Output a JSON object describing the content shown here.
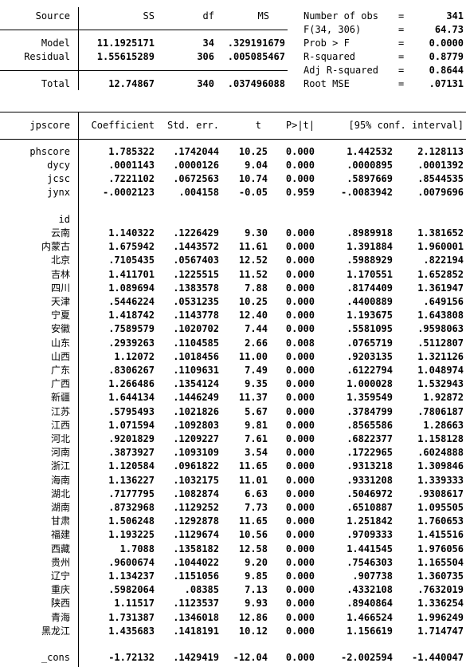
{
  "anova": {
    "headers": {
      "source": "Source",
      "ss": "SS",
      "df": "df",
      "ms": "MS"
    },
    "rows": [
      {
        "source": "Model",
        "ss": "11.1925171",
        "df": "34",
        "ms": ".329191679"
      },
      {
        "source": "Residual",
        "ss": "1.55615289",
        "df": "306",
        "ms": ".005085467"
      }
    ],
    "total": {
      "source": "Total",
      "ss": "12.74867",
      "df": "340",
      "ms": ".037496088"
    }
  },
  "stats": [
    {
      "label": "Number of obs",
      "eq": "=",
      "value": "341"
    },
    {
      "label": "F(34, 306)",
      "eq": "=",
      "value": "64.73"
    },
    {
      "label": "Prob > F",
      "eq": "=",
      "value": "0.0000"
    },
    {
      "label": "R-squared",
      "eq": "=",
      "value": "0.8779"
    },
    {
      "label": "Adj R-squared",
      "eq": "=",
      "value": "0.8644"
    },
    {
      "label": "Root MSE",
      "eq": "=",
      "value": ".07131"
    }
  ],
  "coef_header": {
    "var": "jpscore",
    "coef": "Coefficient",
    "se": "Std. err.",
    "t": "t",
    "p": "P>|t|",
    "ci": "[95% conf. interval]"
  },
  "vars": [
    {
      "name": "phscore",
      "coef": "1.785322",
      "se": ".1742044",
      "t": "10.25",
      "p": "0.000",
      "lo": "1.442532",
      "hi": "2.128113"
    },
    {
      "name": "dycy",
      "coef": ".0001143",
      "se": ".0000126",
      "t": "9.04",
      "p": "0.000",
      "lo": ".0000895",
      "hi": ".0001392"
    },
    {
      "name": "jcsc",
      "coef": ".7221102",
      "se": ".0672563",
      "t": "10.74",
      "p": "0.000",
      "lo": ".5897669",
      "hi": ".8544535"
    },
    {
      "name": "jynx",
      "coef": "-.0002123",
      "se": ".004158",
      "t": "-0.05",
      "p": "0.959",
      "lo": "-.0083942",
      "hi": ".0079696"
    }
  ],
  "id_label": "id",
  "ids": [
    {
      "name": "云南",
      "coef": "1.140322",
      "se": ".1226429",
      "t": "9.30",
      "p": "0.000",
      "lo": ".8989918",
      "hi": "1.381652"
    },
    {
      "name": "内蒙古",
      "coef": "1.675942",
      "se": ".1443572",
      "t": "11.61",
      "p": "0.000",
      "lo": "1.391884",
      "hi": "1.960001"
    },
    {
      "name": "北京",
      "coef": ".7105435",
      "se": ".0567403",
      "t": "12.52",
      "p": "0.000",
      "lo": ".5988929",
      "hi": ".822194"
    },
    {
      "name": "吉林",
      "coef": "1.411701",
      "se": ".1225515",
      "t": "11.52",
      "p": "0.000",
      "lo": "1.170551",
      "hi": "1.652852"
    },
    {
      "name": "四川",
      "coef": "1.089694",
      "se": ".1383578",
      "t": "7.88",
      "p": "0.000",
      "lo": ".8174409",
      "hi": "1.361947"
    },
    {
      "name": "天津",
      "coef": ".5446224",
      "se": ".0531235",
      "t": "10.25",
      "p": "0.000",
      "lo": ".4400889",
      "hi": ".649156"
    },
    {
      "name": "宁夏",
      "coef": "1.418742",
      "se": ".1143778",
      "t": "12.40",
      "p": "0.000",
      "lo": "1.193675",
      "hi": "1.643808"
    },
    {
      "name": "安徽",
      "coef": ".7589579",
      "se": ".1020702",
      "t": "7.44",
      "p": "0.000",
      "lo": ".5581095",
      "hi": ".9598063"
    },
    {
      "name": "山东",
      "coef": ".2939263",
      "se": ".1104585",
      "t": "2.66",
      "p": "0.008",
      "lo": ".0765719",
      "hi": ".5112807"
    },
    {
      "name": "山西",
      "coef": "1.12072",
      "se": ".1018456",
      "t": "11.00",
      "p": "0.000",
      "lo": ".9203135",
      "hi": "1.321126"
    },
    {
      "name": "广东",
      "coef": ".8306267",
      "se": ".1109631",
      "t": "7.49",
      "p": "0.000",
      "lo": ".6122794",
      "hi": "1.048974"
    },
    {
      "name": "广西",
      "coef": "1.266486",
      "se": ".1354124",
      "t": "9.35",
      "p": "0.000",
      "lo": "1.000028",
      "hi": "1.532943"
    },
    {
      "name": "新疆",
      "coef": "1.644134",
      "se": ".1446249",
      "t": "11.37",
      "p": "0.000",
      "lo": "1.359549",
      "hi": "1.92872"
    },
    {
      "name": "江苏",
      "coef": ".5795493",
      "se": ".1021826",
      "t": "5.67",
      "p": "0.000",
      "lo": ".3784799",
      "hi": ".7806187"
    },
    {
      "name": "江西",
      "coef": "1.071594",
      "se": ".1092803",
      "t": "9.81",
      "p": "0.000",
      "lo": ".8565586",
      "hi": "1.28663"
    },
    {
      "name": "河北",
      "coef": ".9201829",
      "se": ".1209227",
      "t": "7.61",
      "p": "0.000",
      "lo": ".6822377",
      "hi": "1.158128"
    },
    {
      "name": "河南",
      "coef": ".3873927",
      "se": ".1093109",
      "t": "3.54",
      "p": "0.000",
      "lo": ".1722965",
      "hi": ".6024888"
    },
    {
      "name": "浙江",
      "coef": "1.120584",
      "se": ".0961822",
      "t": "11.65",
      "p": "0.000",
      "lo": ".9313218",
      "hi": "1.309846"
    },
    {
      "name": "海南",
      "coef": "1.136227",
      "se": ".1032175",
      "t": "11.01",
      "p": "0.000",
      "lo": ".9331208",
      "hi": "1.339333"
    },
    {
      "name": "湖北",
      "coef": ".7177795",
      "se": ".1082874",
      "t": "6.63",
      "p": "0.000",
      "lo": ".5046972",
      "hi": ".9308617"
    },
    {
      "name": "湖南",
      "coef": ".8732968",
      "se": ".1129252",
      "t": "7.73",
      "p": "0.000",
      "lo": ".6510887",
      "hi": "1.095505"
    },
    {
      "name": "甘肃",
      "coef": "1.506248",
      "se": ".1292878",
      "t": "11.65",
      "p": "0.000",
      "lo": "1.251842",
      "hi": "1.760653"
    },
    {
      "name": "福建",
      "coef": "1.193225",
      "se": ".1129674",
      "t": "10.56",
      "p": "0.000",
      "lo": ".9709333",
      "hi": "1.415516"
    },
    {
      "name": "西藏",
      "coef": "1.7088",
      "se": ".1358182",
      "t": "12.58",
      "p": "0.000",
      "lo": "1.441545",
      "hi": "1.976056"
    },
    {
      "name": "贵州",
      "coef": ".9600674",
      "se": ".1044022",
      "t": "9.20",
      "p": "0.000",
      "lo": ".7546303",
      "hi": "1.165504"
    },
    {
      "name": "辽宁",
      "coef": "1.134237",
      "se": ".1151056",
      "t": "9.85",
      "p": "0.000",
      "lo": ".907738",
      "hi": "1.360735"
    },
    {
      "name": "重庆",
      "coef": ".5982064",
      "se": ".08385",
      "t": "7.13",
      "p": "0.000",
      "lo": ".4332108",
      "hi": ".7632019"
    },
    {
      "name": "陕西",
      "coef": "1.11517",
      "se": ".1123537",
      "t": "9.93",
      "p": "0.000",
      "lo": ".8940864",
      "hi": "1.336254"
    },
    {
      "name": "青海",
      "coef": "1.731387",
      "se": ".1346018",
      "t": "12.86",
      "p": "0.000",
      "lo": "1.466524",
      "hi": "1.996249"
    },
    {
      "name": "黑龙江",
      "coef": "1.435683",
      "se": ".1418191",
      "t": "10.12",
      "p": "0.000",
      "lo": "1.156619",
      "hi": "1.714747"
    }
  ],
  "cons": {
    "name": "_cons",
    "coef": "-1.72132",
    "se": ".1429419",
    "t": "-12.04",
    "p": "0.000",
    "lo": "-2.002594",
    "hi": "-1.440047"
  }
}
